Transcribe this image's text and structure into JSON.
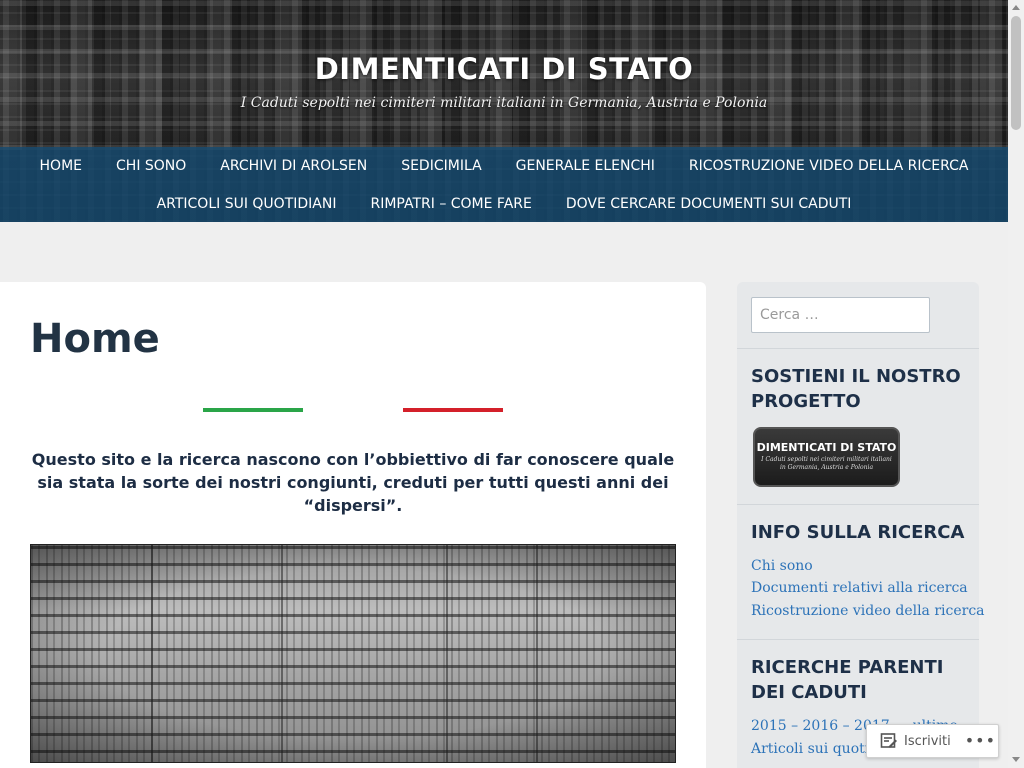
{
  "header": {
    "title": "DIMENTICATI DI STATO",
    "tagline": "I Caduti sepolti nei cimiteri militari italiani in Germania, Austria e Polonia"
  },
  "nav": {
    "row1": [
      "HOME",
      "CHI SONO",
      "ARCHIVI DI AROLSEN",
      "SEDICIMILA",
      "GENERALE ELENCHI",
      "RICOSTRUZIONE VIDEO DELLA RICERCA"
    ],
    "row2": [
      "ARTICOLI SUI QUOTIDIANI",
      "RIMPATRI – COME FARE",
      "DOVE CERCARE DOCUMENTI SUI CADUTI"
    ]
  },
  "main": {
    "title": "Home",
    "intro": "Questo sito e la ricerca nascono con l’obbiettivo di far conoscere quale sia stata la sorte dei nostri congiunti, creduti per tutti questi anni dei “dispersi”.",
    "colors": {
      "flag_green": "#2aa548",
      "flag_red": "#d4202a"
    }
  },
  "sidebar": {
    "search_placeholder": "Cerca …",
    "support": {
      "title": "SOSTIENI IL NOSTRO PROGETTO",
      "banner_title": "DIMENTICATI DI STATO",
      "banner_subtitle": "I Caduti sepolti nei cimiteri militari italiani in Germania, Austria e Polonia"
    },
    "info": {
      "title": "INFO SULLA RICERCA",
      "links": [
        "Chi sono",
        "Documenti relativi alla ricerca",
        "Ricostruzione video della ricerca"
      ]
    },
    "parents": {
      "title": "RICERCHE PARENTI DEI CADUTI",
      "links": [
        "2015 – 2016 – 2017 … ultime",
        "Articoli sui quotidiani"
      ]
    }
  },
  "follow": {
    "label": "Iscriviti",
    "more": "•••"
  }
}
